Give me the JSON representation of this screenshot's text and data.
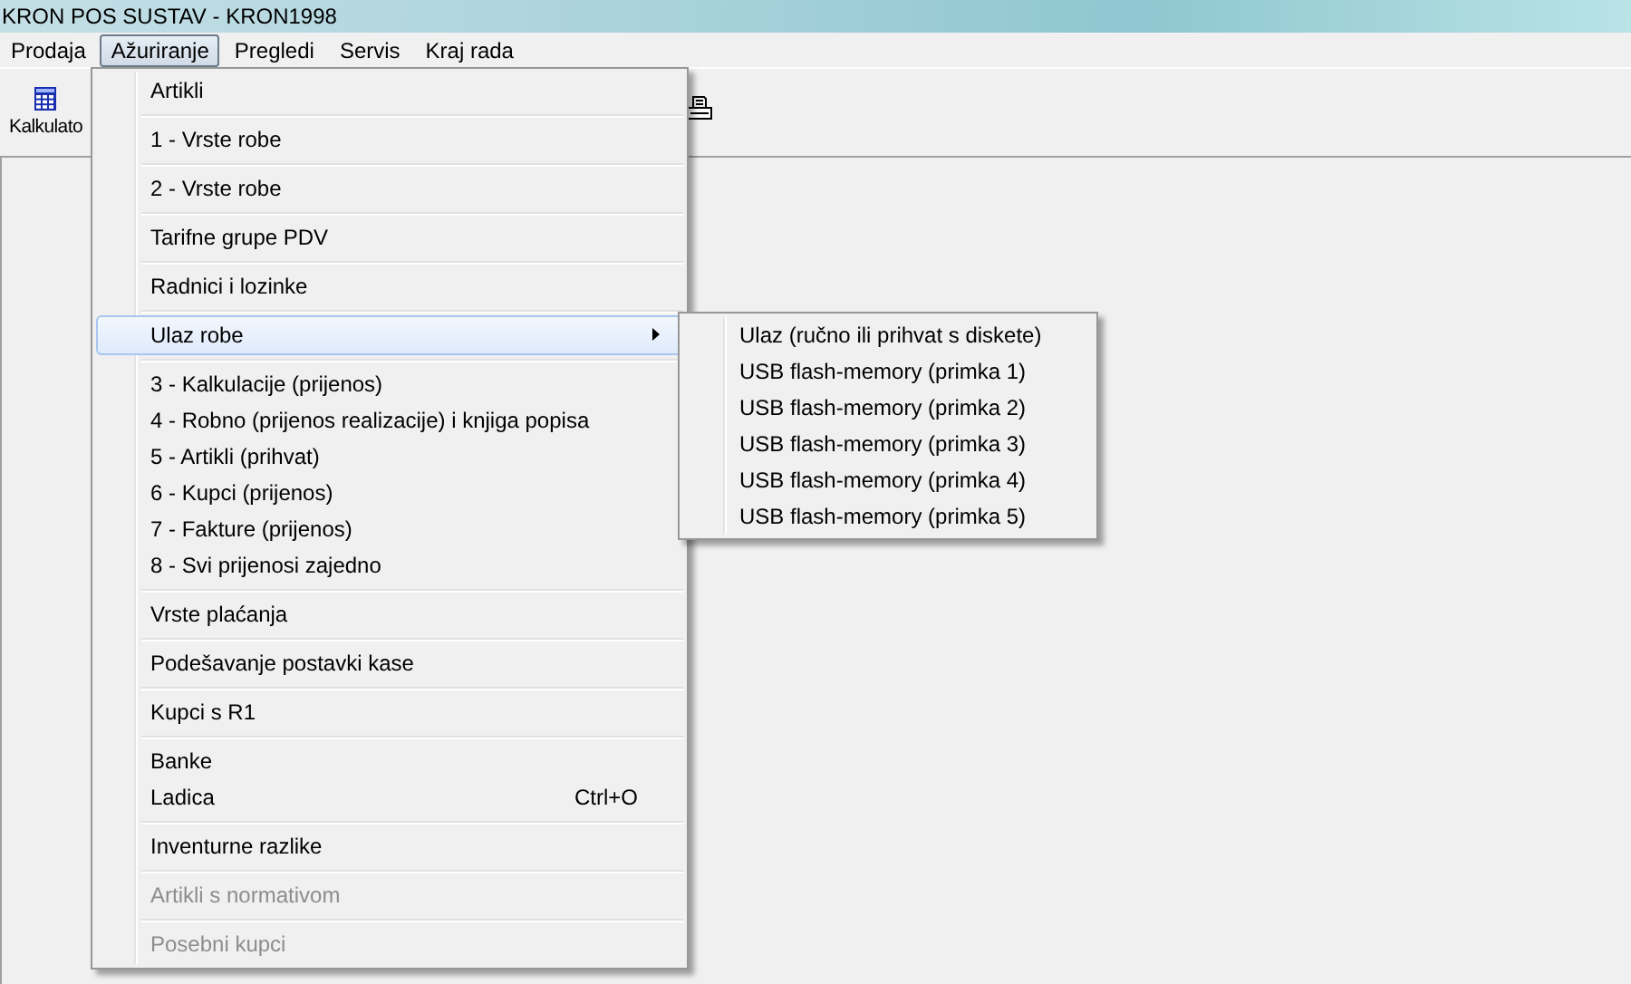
{
  "window": {
    "title": "KRON POS SUSTAV - KRON1998"
  },
  "menubar": [
    {
      "label": "Prodaja",
      "selected": false
    },
    {
      "label": "Ažuriranje",
      "selected": true
    },
    {
      "label": "Pregledi",
      "selected": false
    },
    {
      "label": "Servis",
      "selected": false
    },
    {
      "label": "Kraj rada",
      "selected": false
    }
  ],
  "toolbar": [
    {
      "label": "Kalkulato",
      "kind": "calculator"
    },
    {
      "kind": "printer"
    }
  ],
  "menu": {
    "groups": [
      {
        "items": [
          {
            "label": "Artikli",
            "disabled": false,
            "selected": false
          }
        ]
      },
      {
        "items": [
          {
            "label": "1 - Vrste robe",
            "disabled": false,
            "selected": false
          }
        ]
      },
      {
        "items": [
          {
            "label": "2 - Vrste robe",
            "disabled": false,
            "selected": false
          }
        ]
      },
      {
        "items": [
          {
            "label": "Tarifne grupe PDV",
            "disabled": false,
            "selected": false
          }
        ]
      },
      {
        "items": [
          {
            "label": "Radnici i lozinke",
            "disabled": false,
            "selected": false
          }
        ]
      },
      {
        "items": [
          {
            "label": "Ulaz robe",
            "disabled": false,
            "selected": true,
            "submenu": [
              {
                "label": "Ulaz (ručno ili prihvat s diskete)"
              },
              {
                "label": "USB flash-memory (primka 1)"
              },
              {
                "label": "USB flash-memory (primka 2)"
              },
              {
                "label": "USB flash-memory (primka 3)"
              },
              {
                "label": "USB flash-memory (primka 4)"
              },
              {
                "label": "USB flash-memory (primka 5)"
              }
            ]
          }
        ]
      },
      {
        "items": [
          {
            "label": "3 - Kalkulacije (prijenos)",
            "disabled": false,
            "selected": false
          },
          {
            "label": "4 - Robno (prijenos realizacije) i knjiga popisa",
            "disabled": false,
            "selected": false
          },
          {
            "label": "5 - Artikli (prihvat)",
            "disabled": false,
            "selected": false
          },
          {
            "label": "6 - Kupci (prijenos)",
            "disabled": false,
            "selected": false
          },
          {
            "label": "7 - Fakture (prijenos)",
            "disabled": false,
            "selected": false
          },
          {
            "label": "8 - Svi prijenosi zajedno",
            "disabled": false,
            "selected": false
          }
        ]
      },
      {
        "items": [
          {
            "label": "Vrste plaćanja",
            "disabled": false,
            "selected": false
          }
        ]
      },
      {
        "items": [
          {
            "label": "Podešavanje postavki kase",
            "disabled": false,
            "selected": false
          }
        ]
      },
      {
        "items": [
          {
            "label": "Kupci s R1",
            "disabled": false,
            "selected": false
          }
        ]
      },
      {
        "items": [
          {
            "label": "Banke",
            "disabled": false,
            "selected": false
          },
          {
            "label": "Ladica",
            "disabled": false,
            "selected": false,
            "shortcut": "Ctrl+O"
          }
        ]
      },
      {
        "items": [
          {
            "label": "Inventurne razlike",
            "disabled": false,
            "selected": false
          }
        ]
      },
      {
        "items": [
          {
            "label": "Artikli s normativom",
            "disabled": true,
            "selected": false
          }
        ]
      },
      {
        "items": [
          {
            "label": "Posebni kupci",
            "disabled": true,
            "selected": false
          }
        ]
      }
    ]
  }
}
